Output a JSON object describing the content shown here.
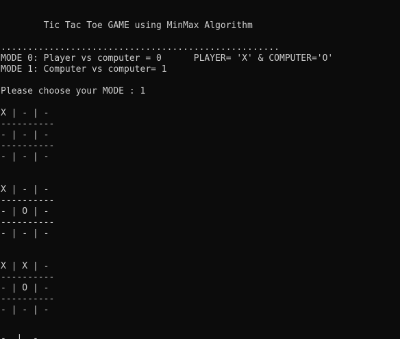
{
  "console": {
    "title": "        Tic Tac Toe GAME using MinMax Algorithm",
    "dots": "....................................................",
    "mode0": "MODE 0: Player vs computer = 0      PLAYER= 'X' & COMPUTER='O'",
    "mode1": "MODE 1: Computer vs computer= 1",
    "prompt": "Please choose your MODE : 1",
    "board1": {
      "row1": "X | - | -",
      "sep1": "----------",
      "row2": "- | - | -",
      "sep2": "----------",
      "row3": "- | - | -"
    },
    "board2": {
      "row1": "X | - | -",
      "sep1": "----------",
      "row2": "- | O | -",
      "sep2": "----------",
      "row3": "- | - | -"
    },
    "board3": {
      "row1": "X | X | -",
      "sep1": "----------",
      "row2": "- | O | -",
      "sep2": "----------",
      "row3": "- | - | -"
    },
    "partial": "-  |  -"
  }
}
